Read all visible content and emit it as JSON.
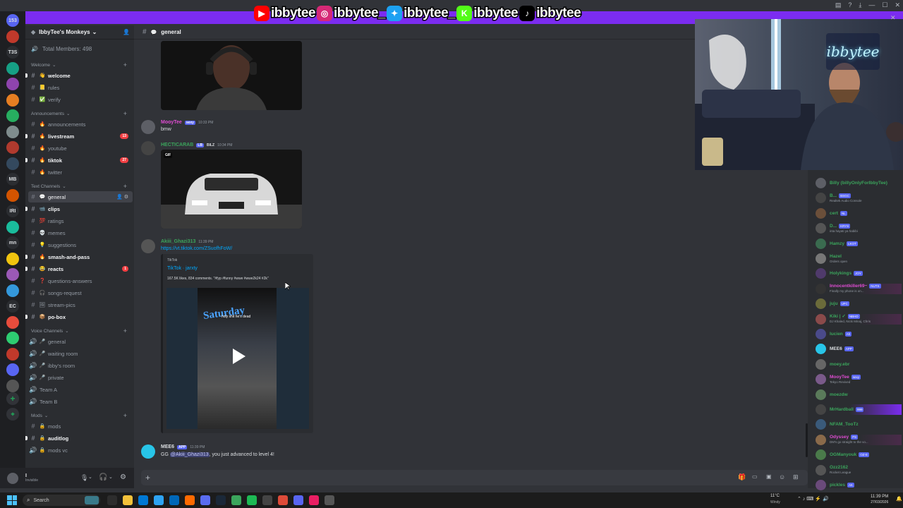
{
  "banner": {
    "handles": [
      {
        "platform": "youtube",
        "icon": "youtube-icon",
        "color": "#ff0000",
        "name": "ibbytee"
      },
      {
        "platform": "instagram",
        "icon": "instagram-icon",
        "color": "#d62976",
        "name": "ibbytee_"
      },
      {
        "platform": "twitter",
        "icon": "twitter-icon",
        "color": "#1da1f2",
        "name": "ibbytee_"
      },
      {
        "platform": "kick",
        "icon": "kick-icon",
        "color": "#53fc18",
        "name": "ibbytee"
      },
      {
        "platform": "tiktok",
        "icon": "tiktok-icon",
        "color": "#000000",
        "name": "ibbytee"
      }
    ],
    "overlay_text": "IbbyTee's Monk"
  },
  "rail": {
    "servers": [
      "153",
      "",
      "T3S",
      "",
      "",
      "",
      "",
      "",
      "",
      "",
      "MB",
      "",
      "IRI",
      "",
      "mn",
      "",
      "",
      "",
      "EC",
      "",
      "",
      "",
      "",
      ""
    ]
  },
  "sidebar": {
    "server_name": "IbbyTee's Monkeys",
    "total_members": "Total Members: 498",
    "categories": [
      {
        "name": "Welcome",
        "channels": [
          {
            "name": "welcome",
            "emoji": "👋",
            "unread": true
          },
          {
            "name": "rules",
            "emoji": "📒"
          },
          {
            "name": "verify",
            "emoji": "✅"
          }
        ]
      },
      {
        "name": "Announcements",
        "channels": [
          {
            "name": "announcements",
            "emoji": "🔥"
          },
          {
            "name": "livestream",
            "emoji": "🔥",
            "unread": true,
            "badge": "13"
          },
          {
            "name": "youtube",
            "emoji": "🔥"
          },
          {
            "name": "tiktok",
            "emoji": "🔥",
            "unread": true,
            "badge": "27"
          },
          {
            "name": "twitter",
            "emoji": "🔥"
          }
        ]
      },
      {
        "name": "Text Channels",
        "channels": [
          {
            "name": "general",
            "emoji": "💬",
            "active": true
          },
          {
            "name": "clips",
            "emoji": "📹",
            "unread": true
          },
          {
            "name": "ratings",
            "emoji": "💯"
          },
          {
            "name": "memes",
            "emoji": "💀"
          },
          {
            "name": "suggestions",
            "emoji": "💡"
          },
          {
            "name": "smash-and-pass",
            "emoji": "🔥",
            "unread": true
          },
          {
            "name": "reacts",
            "emoji": "😂",
            "unread": true,
            "badge": "1"
          },
          {
            "name": "questions-answers",
            "emoji": "❓"
          },
          {
            "name": "songs-request",
            "emoji": "🎧"
          },
          {
            "name": "stream-pics",
            "emoji": "🖼"
          },
          {
            "name": "po-box",
            "emoji": "📦",
            "unread": true
          }
        ]
      },
      {
        "name": "Voice Channels",
        "channels": [
          {
            "name": "general",
            "emoji": "🎤",
            "voice": true
          },
          {
            "name": "waiting room",
            "emoji": "🎤",
            "voice": true
          },
          {
            "name": "ibby's room",
            "emoji": "🎤",
            "voice": true
          },
          {
            "name": "private",
            "emoji": "🎤",
            "voice": true
          },
          {
            "name": "Team A",
            "emoji": "",
            "voice": true
          },
          {
            "name": "Team B",
            "emoji": "",
            "voice": true
          }
        ]
      },
      {
        "name": "Mods",
        "channels": [
          {
            "name": "mods",
            "emoji": "🔒"
          },
          {
            "name": "auditlog",
            "emoji": "🔒",
            "unread": true
          },
          {
            "name": "mods vc",
            "emoji": "🔒",
            "voice": true
          }
        ]
      }
    ],
    "user": {
      "name": "I",
      "status": "Invisible"
    }
  },
  "channel": {
    "name": "general"
  },
  "messages": [
    {
      "author": "MooyTee",
      "author_color": "#e04cd3",
      "tag": "sexy",
      "time": "10:33 PM",
      "text": "bmw",
      "avatar": "#5d5f66"
    },
    {
      "author": "HECTICARAB",
      "author_color": "#3ba55c",
      "tag": "LB",
      "tag2": "BILZ",
      "time": "10:34 PM",
      "gif": "GIF",
      "avatar": "#444"
    },
    {
      "author": "Akiii_Ghazi313",
      "author_color": "#3ba55c",
      "time": "11:39 PM",
      "link": "https://vt.tiktok.com/ZSuofhFoW/",
      "avatar": "#555",
      "embed": {
        "provider": "TikTok",
        "title": "TikTok · jarxty",
        "desc": "167.5K likes, 834 comments. \"#fyp #funny #wwe #wwe2k24 #2k\"",
        "video_caption": "holy shit he's dead",
        "video_title": "Saturday"
      }
    },
    {
      "author": "MEE6",
      "author_color": "#dbdee1",
      "tag": "APP",
      "time": "11:39 PM",
      "text_prefix": "GG ",
      "mention": "@Akiii_Ghazi313",
      "text_suffix": ", you just advanced to level 4!",
      "avatar": "#28c5e8"
    }
  ],
  "members": [
    {
      "name": "Billy (billyOnlyForIbbyTee)",
      "color": "#3ba55c"
    },
    {
      "name": "B...",
      "tag": "BSGC",
      "sub": "Realtek Audio Console",
      "color": "#3ba55c"
    },
    {
      "name": "cert",
      "tag": "NL",
      "color": "#3ba55c"
    },
    {
      "name": "D...",
      "tag": "KRYS",
      "sub": "inta hayati ya habibi",
      "color": "#3ba55c"
    },
    {
      "name": "Hamzy",
      "tag": "LKOT",
      "color": "#3ba55c"
    },
    {
      "name": "Hazel",
      "sub": "Orders open",
      "color": "#3ba55c"
    },
    {
      "name": "Holykings",
      "tag": "JOY",
      "color": "#3ba55c"
    },
    {
      "name": "Innocentkiller69~",
      "tag": "NUTS",
      "sub": "Finally my phone is on...",
      "color": "#e04cd3"
    },
    {
      "name": "juju",
      "tag": "UFC",
      "color": "#3ba55c"
    },
    {
      "name": "Kiki | ✓",
      "tag": "NBHD",
      "sub": "DJ Khaled, Nicki Minaj, Chris",
      "color": "#3ba55c"
    },
    {
      "name": "lucien",
      "tag": "Ah",
      "color": "#3ba55c"
    },
    {
      "name": "MEE6",
      "tag": "APP",
      "color": "#dbdee1"
    },
    {
      "name": "moey.ebr",
      "color": "#3ba55c"
    },
    {
      "name": "MooyTee",
      "tag": "sexy",
      "sub": "Tekyo Revived",
      "color": "#e04cd3"
    },
    {
      "name": "moezdw",
      "color": "#3ba55c"
    },
    {
      "name": "MrHardball",
      "tag": "999",
      "color": "#3ba55c"
    },
    {
      "name": "NFAM_TooTz",
      "color": "#3ba55c"
    },
    {
      "name": "Odyssey",
      "tag": "PS",
      "sub": "DM's go straight to the vo...",
      "color": "#e04cd3"
    },
    {
      "name": "OGManyouk",
      "tag": "OZ-E",
      "color": "#3ba55c"
    },
    {
      "name": "Ozz2162",
      "sub": "Rocket League",
      "color": "#3ba55c"
    },
    {
      "name": "pickles",
      "tag": "AK",
      "color": "#3ba55c"
    }
  ],
  "webcam": {
    "neon_text": "ibbytee"
  },
  "taskbar": {
    "search_placeholder": "Search",
    "weather": "11°C",
    "weather_sub": "Windy",
    "time": "11:39 PM",
    "date": "27/03/2026"
  },
  "colors": {
    "accent": "#7b2cf0",
    "online": "#23a55a",
    "link": "#00a8fc"
  }
}
